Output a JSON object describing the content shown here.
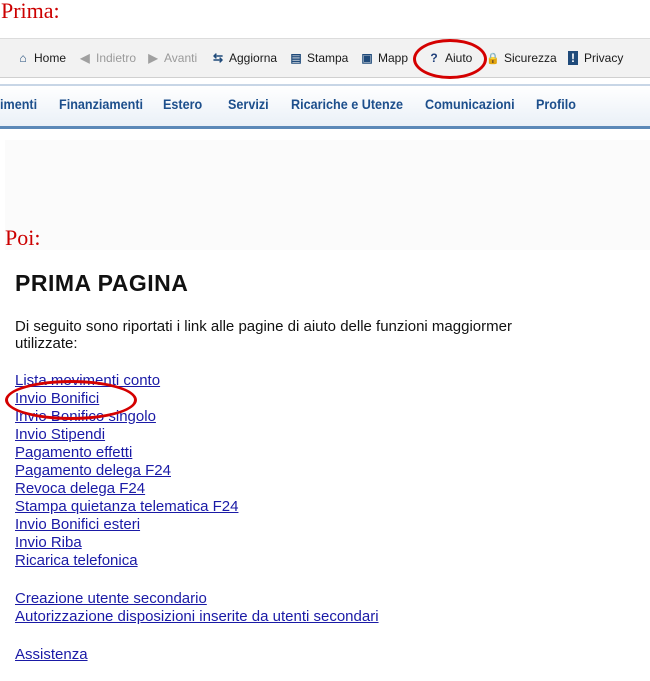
{
  "labels": {
    "before": "Prima:",
    "after": "Poi:"
  },
  "toolbar": {
    "items": [
      {
        "label": "Home",
        "icon": "home-icon",
        "glyph": "⌂",
        "disabled": false
      },
      {
        "label": "Indietro",
        "icon": "back-icon",
        "glyph": "◀",
        "disabled": true
      },
      {
        "label": "Avanti",
        "icon": "forward-icon",
        "glyph": "▶",
        "disabled": true
      },
      {
        "label": "Aggiorna",
        "icon": "refresh-icon",
        "glyph": "⇆",
        "disabled": false
      },
      {
        "label": "Stampa",
        "icon": "print-icon",
        "glyph": "▤",
        "disabled": false
      },
      {
        "label": "Mappa",
        "icon": "map-icon",
        "glyph": "▣",
        "disabled": false
      },
      {
        "label": "Aiuto",
        "icon": "help-icon",
        "glyph": "?",
        "disabled": false
      },
      {
        "label": "Sicurezza",
        "icon": "lock-icon",
        "glyph": "🔒",
        "disabled": false
      },
      {
        "label": "Privacy",
        "icon": "info-icon",
        "glyph": "!",
        "disabled": false
      }
    ]
  },
  "navbar": {
    "items": [
      "imenti",
      "Finanziamenti",
      "Estero",
      "Servizi",
      "Ricariche e Utenze",
      "Comunicazioni",
      "Profilo"
    ]
  },
  "help_page": {
    "title": "PRIMA PAGINA",
    "intro_line1": "Di seguito sono riportati i link alle pagine di aiuto delle funzioni maggiormer",
    "intro_line2": "utilizzate:",
    "links": [
      "Lista movimenti conto",
      "Invio Bonifici",
      "Invio Bonifico singolo",
      "Invio Stipendi",
      "Pagamento effetti",
      "Pagamento delega F24",
      "Revoca delega F24",
      "Stampa quietanza telematica F24",
      "Invio Bonifici esteri",
      "Invio Riba",
      "Ricarica telefonica"
    ],
    "links2": [
      "Creazione utente secondario",
      "Autorizzazione disposizioni inserite da utenti secondari"
    ],
    "links3": [
      "Assistenza"
    ]
  },
  "colors": {
    "annotation_red": "#d40000",
    "link_blue": "#1a1aa6",
    "nav_blue": "#1d4f8c"
  }
}
